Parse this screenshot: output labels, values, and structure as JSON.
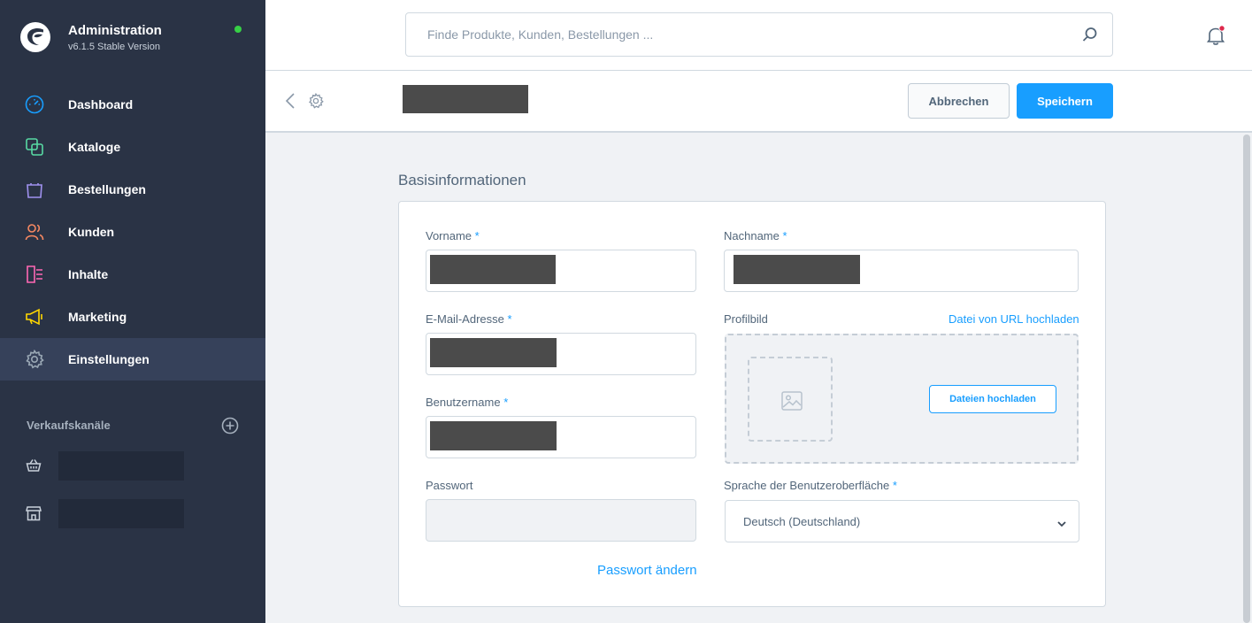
{
  "brand": {
    "title": "Administration",
    "version": "v6.1.5 Stable Version",
    "status_color": "#37d046"
  },
  "nav": {
    "items": [
      {
        "label": "Dashboard",
        "icon": "dashboard-gauge-icon",
        "color": "#189eff"
      },
      {
        "label": "Kataloge",
        "icon": "catalog-icon",
        "color": "#57d9a3"
      },
      {
        "label": "Bestellungen",
        "icon": "shopping-bag-icon",
        "color": "#a092f0"
      },
      {
        "label": "Kunden",
        "icon": "customers-icon",
        "color": "#f88962"
      },
      {
        "label": "Inhalte",
        "icon": "content-icon",
        "color": "#ff68b4"
      },
      {
        "label": "Marketing",
        "icon": "megaphone-icon",
        "color": "#ffd700"
      },
      {
        "label": "Einstellungen",
        "icon": "settings-gear-icon",
        "color": "#9aa8b5",
        "active": true
      }
    ]
  },
  "channels": {
    "heading": "Verkaufskanäle",
    "items": [
      {
        "icon": "basket-icon"
      },
      {
        "icon": "storefront-icon"
      }
    ]
  },
  "header": {
    "search_placeholder": "Finde Produkte, Kunden, Bestellungen ..."
  },
  "actions": {
    "cancel_label": "Abbrechen",
    "save_label": "Speichern",
    "accent": "#189eff"
  },
  "form": {
    "section_title": "Basisinformationen",
    "first_name_label": "Vorname",
    "last_name_label": "Nachname",
    "email_label": "E-Mail-Adresse",
    "profile_image_label": "Profilbild",
    "upload_url_link": "Datei von URL hochladen",
    "upload_button": "Dateien hochladen",
    "username_label": "Benutzername",
    "password_label": "Passwort",
    "language_label": "Sprache der Benutzeroberfläche",
    "language_value": "Deutsch (Deutschland)",
    "change_password_link": "Passwort ändern",
    "required_marker": "*"
  }
}
